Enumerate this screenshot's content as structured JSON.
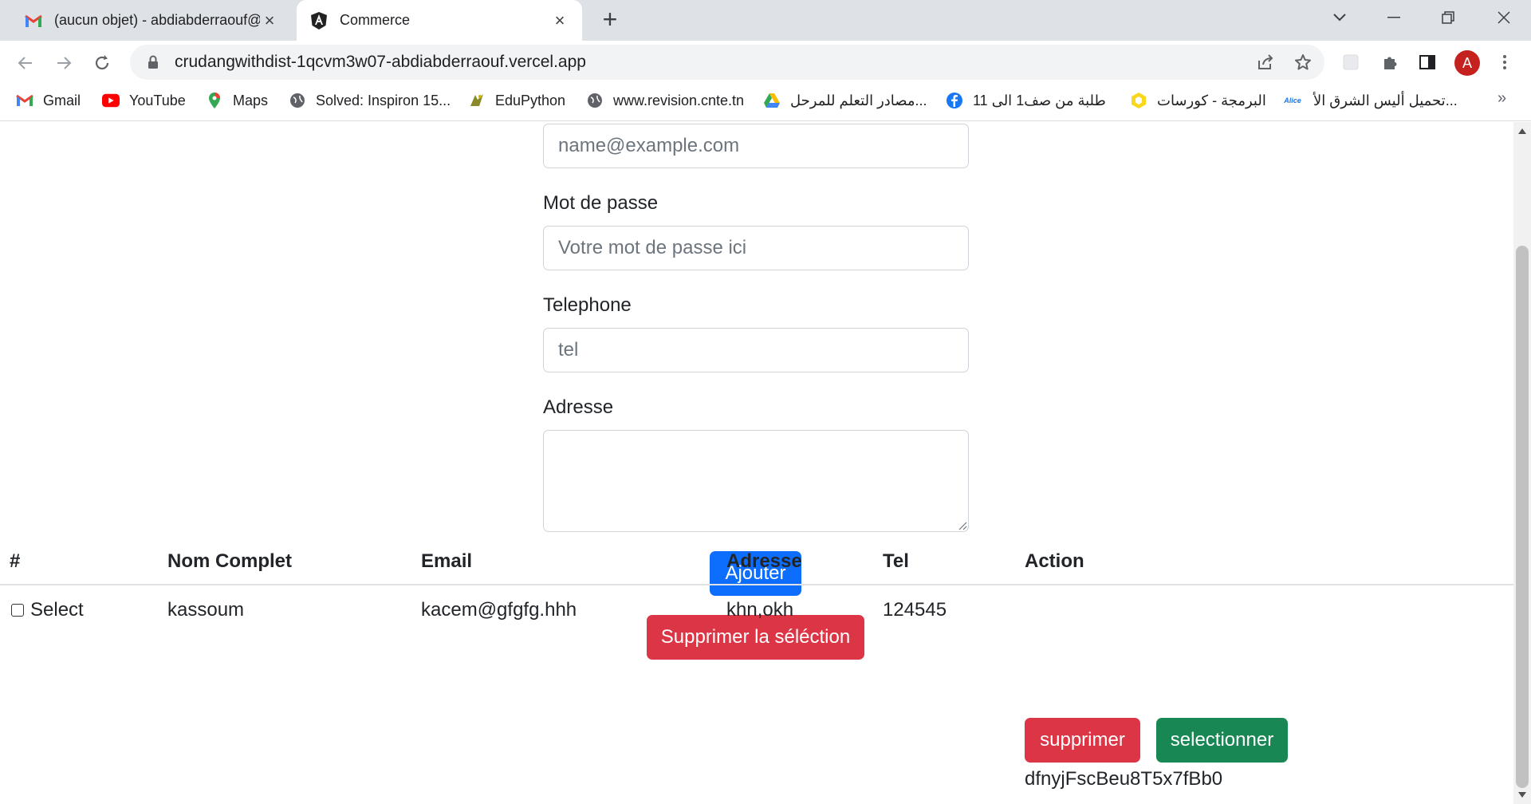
{
  "browser": {
    "tabs": [
      {
        "title": "(aucun objet) - abdiabderraouf@",
        "icon": "gmail-icon",
        "active": false
      },
      {
        "title": "Commerce",
        "icon": "angular-icon",
        "active": true
      }
    ],
    "url": "crudangwithdist-1qcvm3w07-abdiabderraouf.vercel.app",
    "profile_initial": "A",
    "bookmarks": [
      {
        "label": "Gmail",
        "icon": "gmail-icon"
      },
      {
        "label": "YouTube",
        "icon": "youtube-icon"
      },
      {
        "label": "Maps",
        "icon": "maps-icon"
      },
      {
        "label": "Solved: Inspiron 15...",
        "icon": "globe-icon"
      },
      {
        "label": "EduPython",
        "icon": "python-icon"
      },
      {
        "label": "www.revision.cnte.tn",
        "icon": "globe-icon"
      },
      {
        "label": "مصادر التعلم للمرحل...",
        "icon": "drive-icon"
      },
      {
        "label": "طلبة من صف1 الى 11",
        "icon": "facebook-icon"
      },
      {
        "label": "البرمجة - كورسات",
        "icon": "hexagon-icon"
      },
      {
        "label": "تحميل أليس الشرق الأ...",
        "icon": "alice-icon"
      }
    ],
    "bookmark_more": "»",
    "alice_badge": "Alice"
  },
  "form": {
    "email_placeholder": "name@example.com",
    "password_label": "Mot de passe",
    "password_placeholder": "Votre mot de passe ici",
    "phone_label": "Telephone",
    "phone_placeholder": "tel",
    "address_label": "Adresse",
    "address_value": "",
    "submit_label": "Ajouter",
    "delete_selection_label": "Supprimer la séléction"
  },
  "table": {
    "headers": [
      "#",
      "Nom Complet",
      "Email",
      "Adresse",
      "Tel",
      "Action"
    ],
    "rows": [
      {
        "select_label": "Select",
        "name": "kassoum",
        "email": "kacem@gfgfg.hhh",
        "address": "khn,okh",
        "tel": "124545",
        "delete_label": "supprimer",
        "select_button_label": "selectionner",
        "id": "dfnyjFscBeu8T5x7fBb0"
      }
    ]
  },
  "colors": {
    "primary": "#0d6efd",
    "danger": "#dc3545",
    "success": "#198754"
  }
}
